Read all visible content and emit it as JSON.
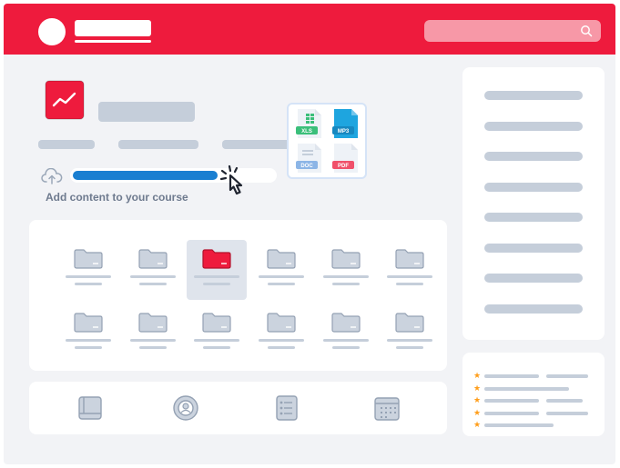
{
  "colors": {
    "brand": "#ee1b3d",
    "placeholder": "#c5ceda",
    "accent": "#1a7fd1",
    "icon_fill": "#cbd3de",
    "icon_stroke": "#94a1b3",
    "star": "#ff9e1b",
    "caption": "#6e7a8e"
  },
  "header": {
    "logo_icon": "white-circle-logo",
    "search_icon": "search-icon"
  },
  "course": {
    "icon": "chart-trend-icon",
    "caption": "Add content to your course",
    "upload_progress": 0.72,
    "upload_icon": "cloud-upload-icon",
    "cursor_icon": "hand-pointer-click-icon"
  },
  "files": [
    {
      "label": "XLS",
      "color": "#3bbf7a"
    },
    {
      "label": "MP3",
      "color": "#1ea5df"
    },
    {
      "label": "DOC",
      "color": "#8cb5e6"
    },
    {
      "label": "PDF",
      "color": "#f0506a"
    }
  ],
  "folders": {
    "rows": 2,
    "columns": 6,
    "active_index": 2,
    "icon": "folder-icon"
  },
  "tools": [
    {
      "icon": "book-icon"
    },
    {
      "icon": "user-badge-icon"
    },
    {
      "icon": "checklist-icon"
    },
    {
      "icon": "calendar-icon"
    }
  ],
  "sidebar": {
    "line_count": 8
  },
  "ratings": {
    "row_count": 5,
    "star_glyph": "★"
  }
}
